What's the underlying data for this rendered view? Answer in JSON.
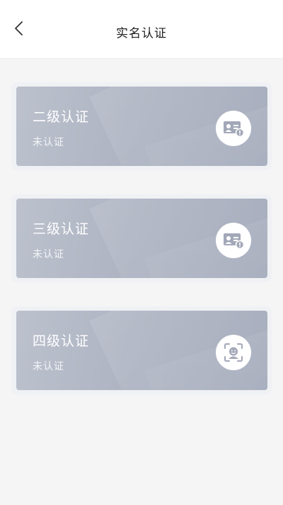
{
  "header": {
    "title": "实名认证",
    "back_icon": "chevron-left-icon"
  },
  "cards": [
    {
      "title": "二级认证",
      "status": "未认证",
      "icon": "id-card-icon"
    },
    {
      "title": "三级认证",
      "status": "未认证",
      "icon": "id-card-icon"
    },
    {
      "title": "四级认证",
      "status": "未认证",
      "icon": "face-scan-icon"
    }
  ],
  "colors": {
    "icon": "#a3a8b8",
    "card": "#aeb4c2"
  }
}
